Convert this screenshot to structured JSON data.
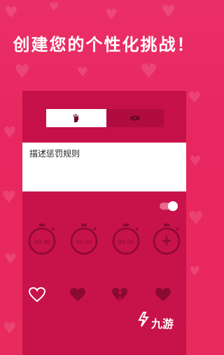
{
  "headline": "创建您的个性化挑战！",
  "segment": {
    "left_icon": "hand-icon",
    "right_icon": "eye-icon"
  },
  "rule_input": {
    "value": "描述惩罚规则"
  },
  "toggle": {
    "state": "on"
  },
  "timers": [
    {
      "label": "00:30"
    },
    {
      "label": "01:00"
    },
    {
      "label": "05:00"
    },
    {
      "label": "+"
    }
  ],
  "heart_options": [
    {
      "icon": "heart-outline-icon"
    },
    {
      "icon": "heart-filled-icon"
    },
    {
      "icon": "heart-broken-icon"
    },
    {
      "icon": "heart-filled-icon"
    }
  ],
  "watermark": "九游",
  "colors": {
    "background": "#ea2f66",
    "card": "#c8124a",
    "accent_white": "#ffffff"
  }
}
